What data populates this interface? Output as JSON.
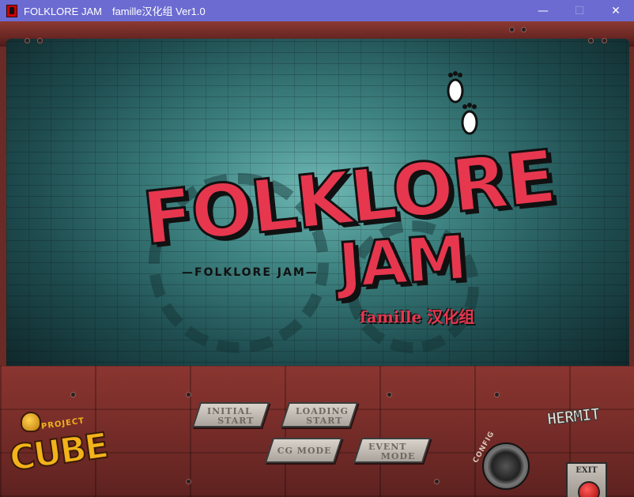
{
  "window": {
    "title": "FOLKLORE JAM　famille汉化组 Ver1.0",
    "minimize_glyph": "—",
    "maximize_glyph": "☐",
    "close_glyph": "✕"
  },
  "logo": {
    "line1": "FOLKLORE",
    "line2": "JAM",
    "subtitle": "—FOLKLORE JAM—",
    "credit": "famille 汉化组",
    "feet_icon": "footprints-icon"
  },
  "menu": {
    "initial_start": [
      "INITIAL",
      "START"
    ],
    "loading_start": [
      "LOADING",
      "START"
    ],
    "cg_mode": "CG MODE",
    "event_mode": [
      "EVENT",
      "MODE"
    ],
    "config": "CONFIG",
    "exit": "EXIT"
  },
  "branding": {
    "project": "PROJECT",
    "cube": "CUBE",
    "hermit": "HERMIT"
  },
  "colors": {
    "titlebar": "#6b6bd1",
    "logo_red": "#e6374f",
    "panel_red": "#7a2e2a",
    "cube_yellow": "#f2b21a"
  }
}
